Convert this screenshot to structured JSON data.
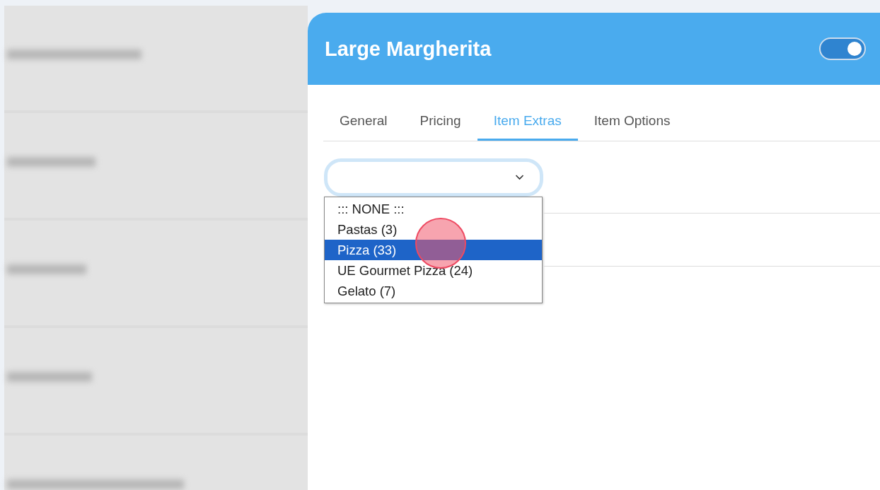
{
  "item_panel": {
    "title": "Large Margherita",
    "toggle": {
      "on": true
    },
    "tabs": [
      {
        "label": "General",
        "selected": false
      },
      {
        "label": "Pricing",
        "selected": false
      },
      {
        "label": "Item Extras",
        "selected": true
      },
      {
        "label": "Item Options",
        "selected": false
      }
    ],
    "extras_select": {
      "options": [
        {
          "label": "::: NONE :::",
          "selected": false
        },
        {
          "label": "Pastas (3)",
          "selected": false
        },
        {
          "label": "Pizza (33)",
          "selected": true
        },
        {
          "label": "UE Gourmet Pizza (24)",
          "selected": false
        },
        {
          "label": "Gelato (7)",
          "selected": false
        }
      ]
    }
  }
}
